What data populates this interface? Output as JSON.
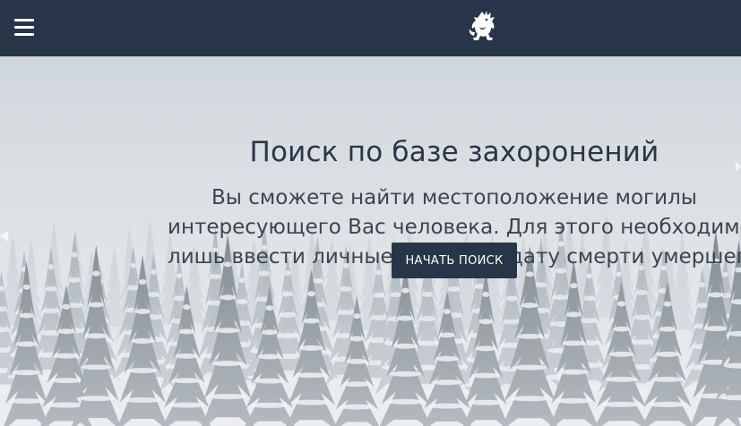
{
  "header": {
    "menu_icon": "hamburger-menu-icon",
    "logo_icon": "dragon-emblem-icon",
    "background_color": "#283548"
  },
  "hero": {
    "title": "Поиск по базе захоронений",
    "subtitle_lines": [
      "Вы сможете найти местоположение могилы",
      "интересующего Вас человека. Для этого необходимо",
      "лишь ввести личные данные и дату смерти умершего"
    ],
    "cta_label": "НАЧАТЬ ПОИСК",
    "background_image": "snowy-forest-image",
    "accent_color": "#283548"
  }
}
